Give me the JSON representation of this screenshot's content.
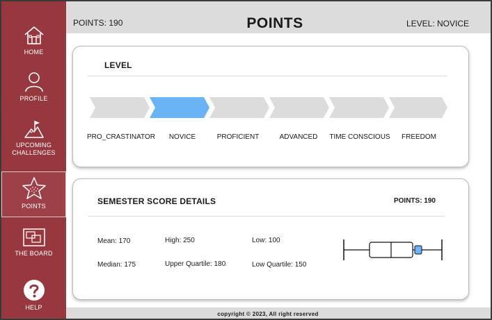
{
  "sidebar": {
    "items": [
      {
        "label": "HOME",
        "icon": "home-icon"
      },
      {
        "label": "PROFILE",
        "icon": "profile-icon"
      },
      {
        "label": "UPCOMING",
        "label2": "CHALLENGES",
        "icon": "mountain-flag-icon"
      },
      {
        "label": "POINTS",
        "icon": "star-icon",
        "active": true
      },
      {
        "label": "THE BOARD",
        "icon": "board-icon"
      },
      {
        "label": "HELP",
        "icon": "help-icon"
      }
    ],
    "color": "#97383f"
  },
  "header": {
    "points": "POINTS: 190",
    "title": "POINTS",
    "level": "LEVEL: NOVICE"
  },
  "level_card": {
    "title": "LEVEL",
    "levels": [
      "PRO_CRASTINATOR",
      "NOVICE",
      "PROFICIENT",
      "ADVANCED",
      "TIME CONSCIOUS",
      "FREEDOM"
    ],
    "current_index": 1,
    "active_color": "#6ab4f5",
    "inactive_color": "#dcdcdc"
  },
  "score_card": {
    "title": "SEMESTER SCORE DETAILS",
    "points": "POINTS: 190",
    "mean": "Mean: 170",
    "high": "High: 250",
    "low": "Low: 100",
    "median": "Median: 175",
    "upper_quartile": "Upper Quartile: 180",
    "low_quartile": "Low Quartile: 150",
    "box_plot": {
      "min": 100,
      "q1": 150,
      "median": 175,
      "q3": 180,
      "max": 250,
      "current": 190,
      "marker_color": "#6ab4f5"
    }
  },
  "footer": {
    "copyright": "copyright © 2023, All right reserved"
  }
}
